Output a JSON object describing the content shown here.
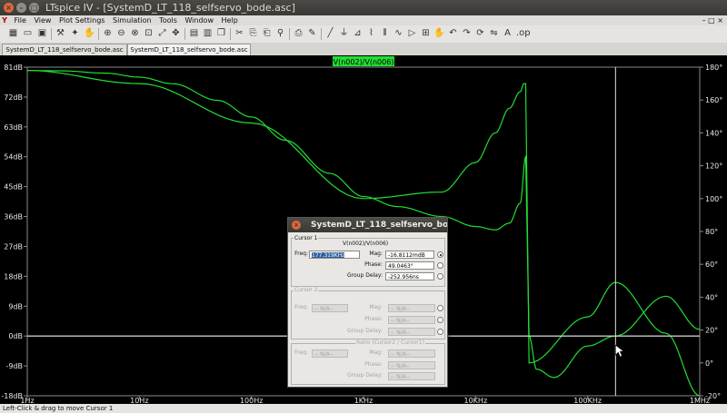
{
  "window": {
    "title": "LTspice IV - [SystemD_LT_118_selfservo_bode.asc]",
    "buttons": {
      "close": "×",
      "minimize": "–",
      "maximize": "□"
    }
  },
  "menu": {
    "app_icon": "Y",
    "items": [
      "File",
      "View",
      "Plot Settings",
      "Simulation",
      "Tools",
      "Window",
      "Help"
    ],
    "mdi_controls": "– □ ×"
  },
  "toolbar": {
    "icons": [
      "new-schematic-icon",
      "open-icon",
      "save-icon",
      "control-panel-icon",
      "run-icon",
      "halt-icon",
      "zoom-in-icon",
      "zoom-out-icon",
      "zoom-fit-icon",
      "zoom-extents-icon",
      "autorange-icon",
      "pan-icon",
      "tile-horizontal-icon",
      "tile-vertical-icon",
      "cascade-icon",
      "delete-icon",
      "duplicate-icon",
      "move-icon",
      "paste-icon",
      "undo-icon",
      "redo-icon",
      "text-icon",
      "spice-directive-icon",
      "wire-icon",
      "ground-icon",
      "label-net-icon",
      "resistor-icon",
      "capacitor-icon",
      "inductor-icon",
      "diode-icon",
      "component-icon",
      "rotate-icon",
      "mirror-icon",
      "drag-icon",
      "find-icon",
      "print-icon"
    ]
  },
  "tabs": [
    {
      "label": "SystemD_LT_118_selfservo_bode.asc"
    },
    {
      "label": "SystemD_LT_118_selfservo_bode.asc"
    }
  ],
  "trace_label": "V(n002)/V(n006)",
  "status": "Left-Click & drag to move Cursor 1",
  "dialog": {
    "title": "SystemD_LT_118_selfservo_bo",
    "close": "×",
    "cursor1": {
      "group": "Cursor 1",
      "expr": "V(n002)/V(n006)",
      "freq_label": "Freq:",
      "freq": "177.319KHz",
      "mag_label": "Mag:",
      "mag": "-16.8112mdB",
      "phase_label": "Phase:",
      "phase": "49.0463°",
      "gd_label": "Group Delay:",
      "gd": "-252.956ns"
    },
    "cursor2": {
      "group": "Cursor 2",
      "freq_label": "Freq:",
      "freq": "-- N/A--",
      "mag_label": "Mag:",
      "mag": "-- N/A--",
      "phase_label": "Phase:",
      "phase": "-- N/A--",
      "gd_label": "Group Delay:",
      "gd": "-- N/A--"
    },
    "ratio": {
      "group": "Ratio (Cursor2 / Cursor1)",
      "freq_label": "Freq:",
      "freq": "-- N/A--",
      "mag_label": "Mag:",
      "mag": "-- N/A--",
      "phase_label": "Phase:",
      "phase": "-- N/A--",
      "gd_label": "Group Delay:",
      "gd": "-- N/A--"
    }
  },
  "colors": {
    "trace": "#22dd33",
    "grid_zero": "#cfcfcf",
    "axis_text": "#e8e8e8",
    "background": "#000000"
  },
  "chart_data": {
    "type": "line",
    "title": "V(n002)/V(n006)",
    "x_scale": "log",
    "xlim": [
      1,
      1000000
    ],
    "x_ticks": [
      "1Hz",
      "10Hz",
      "100Hz",
      "1KHz",
      "10KHz",
      "100KHz",
      "1MHz"
    ],
    "ylim_left": [
      -18,
      81
    ],
    "y_ticks_left": [
      "81dB",
      "72dB",
      "63dB",
      "54dB",
      "45dB",
      "36dB",
      "27dB",
      "18dB",
      "9dB",
      "0dB",
      "-9dB",
      "-18dB"
    ],
    "ylim_right": [
      -20,
      180
    ],
    "y_ticks_right": [
      "180°",
      "160°",
      "140°",
      "120°",
      "100°",
      "80°",
      "60°",
      "40°",
      "20°",
      "0°",
      "-20°"
    ],
    "series": [
      {
        "type": "magnitude_dB",
        "x": [
          1,
          2,
          5,
          10,
          20,
          50,
          100,
          200,
          500,
          1000,
          2000,
          5000,
          10000,
          15000,
          20000,
          25000,
          28000,
          30000,
          35000,
          50000,
          100000,
          177319,
          500000,
          1000000
        ],
        "y": [
          80,
          79.9,
          79.2,
          78,
          76,
          71,
          66,
          59,
          49,
          42,
          39,
          36,
          33,
          32,
          34,
          40,
          54,
          0,
          -10,
          -12.5,
          -3,
          0,
          12,
          2
        ]
      },
      {
        "type": "phase_deg",
        "x": [
          1,
          10,
          100,
          1000,
          5000,
          10000,
          15000,
          20000,
          25000,
          27000,
          28000,
          30000,
          100000,
          177319,
          500000,
          1000000
        ],
        "y": [
          178,
          170,
          146,
          100,
          104,
          122,
          140,
          155,
          165,
          170,
          170,
          0,
          28,
          49,
          18,
          -20
        ]
      }
    ],
    "cursor": {
      "freq": 177319,
      "mag_dB": -0.0168,
      "phase_deg": 49.0463
    },
    "grid": false
  }
}
